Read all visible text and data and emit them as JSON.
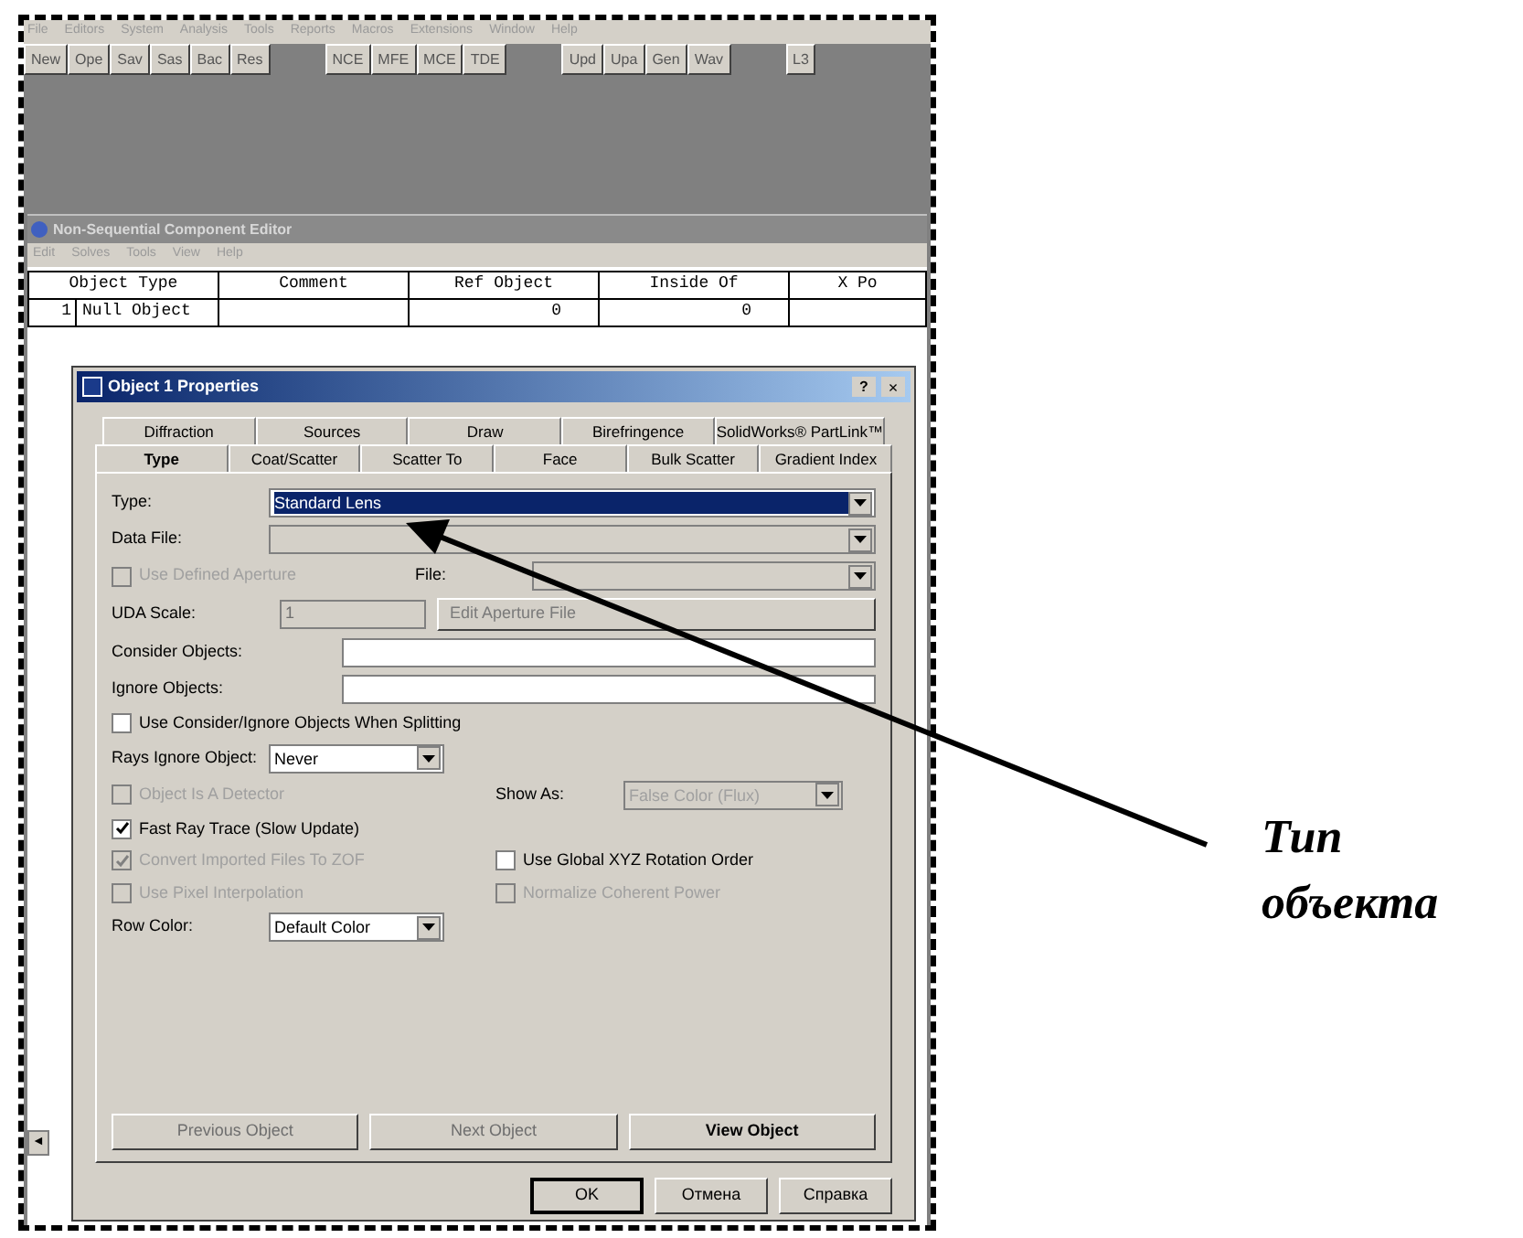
{
  "menu_bar": [
    "File",
    "Editors",
    "System",
    "Analysis",
    "Tools",
    "Reports",
    "Macros",
    "Extensions",
    "Window",
    "Help"
  ],
  "toolbar": {
    "groups": [
      [
        "New",
        "Ope",
        "Sav",
        "Sas",
        "Bac",
        "Res"
      ],
      [
        "NCE",
        "MFE",
        "MCE",
        "TDE"
      ],
      [
        "Upd",
        "Upa",
        "Gen",
        "Wav"
      ],
      [
        "L3"
      ]
    ]
  },
  "editor": {
    "title": "Non-Sequential Component Editor",
    "menu": [
      "Edit",
      "Solves",
      "Tools",
      "View",
      "Help"
    ],
    "columns": [
      "Object Type",
      "Comment",
      "Ref Object",
      "Inside Of",
      "X Po"
    ],
    "rows": [
      {
        "index": "1",
        "cells": [
          "Null Object",
          "",
          "0",
          "0",
          ""
        ]
      }
    ],
    "scroll_left": "◄"
  },
  "dialog": {
    "title": "Object 1 Properties",
    "help": "?",
    "close": "×",
    "tabs_back": [
      {
        "label": "Diffraction",
        "selected": false
      },
      {
        "label": "Sources",
        "selected": false
      },
      {
        "label": "Draw",
        "selected": false
      },
      {
        "label": "Birefringence",
        "selected": false
      },
      {
        "label": "SolidWorks® PartLink™",
        "selected": false
      }
    ],
    "tabs_front": [
      {
        "label": "Type",
        "selected": true
      },
      {
        "label": "Coat/Scatter",
        "selected": false
      },
      {
        "label": "Scatter To",
        "selected": false
      },
      {
        "label": "Face",
        "selected": false
      },
      {
        "label": "Bulk Scatter",
        "selected": false
      },
      {
        "label": "Gradient Index",
        "selected": false
      }
    ],
    "type": {
      "label": "Type:",
      "value": "Standard Lens",
      "highlighted": true
    },
    "data_file": {
      "label": "Data File:",
      "disabled": true
    },
    "uda": {
      "label": "Use Defined Aperture",
      "checked": false,
      "disabled": true
    },
    "file": {
      "label": "File:",
      "disabled": true
    },
    "uda_scale": {
      "label": "UDA Scale:",
      "value": "1",
      "disabled": true
    },
    "edit_button": {
      "label": "Edit Aperture File",
      "disabled": true
    },
    "consider": {
      "label": "Consider Objects:"
    },
    "ignore": {
      "label": "Ignore Objects:"
    },
    "splitting": {
      "label": "Use Consider/Ignore Objects When Splitting",
      "checked": false,
      "disabled": false
    },
    "rays_ignore": {
      "label": "Rays Ignore Object:",
      "value": "Never"
    },
    "detector": {
      "label": "Object Is A Detector",
      "checked": false,
      "disabled": true
    },
    "show_as": {
      "label": "Show As:",
      "value": "False Color (Flux)",
      "disabled": true
    },
    "fast_ray": {
      "label": "Fast Ray Trace (Slow Update)",
      "checked": true,
      "disabled": false
    },
    "convert": {
      "label": "Convert Imported Files To ZOF",
      "checked": true,
      "disabled": true
    },
    "global_xyz": {
      "label": "Use Global XYZ Rotation Order",
      "checked": false,
      "disabled": false
    },
    "pixel": {
      "label": "Use Pixel Interpolation",
      "checked": false,
      "disabled": true
    },
    "normalize": {
      "label": "Normalize Coherent Power",
      "checked": false,
      "disabled": true
    },
    "row_color": {
      "label": "Row Color:",
      "value": "Default Color"
    },
    "nav_buttons": [
      {
        "label": "Previous Object",
        "disabled": true
      },
      {
        "label": "Next Object",
        "disabled": true
      },
      {
        "label": "View Object",
        "disabled": false
      }
    ],
    "footer_buttons": [
      {
        "label": "OK",
        "default": true
      },
      {
        "label": "Отмена",
        "default": false
      },
      {
        "label": "Справка",
        "default": false
      }
    ]
  },
  "annotation": {
    "lines": [
      "Тип",
      "объекта"
    ]
  }
}
